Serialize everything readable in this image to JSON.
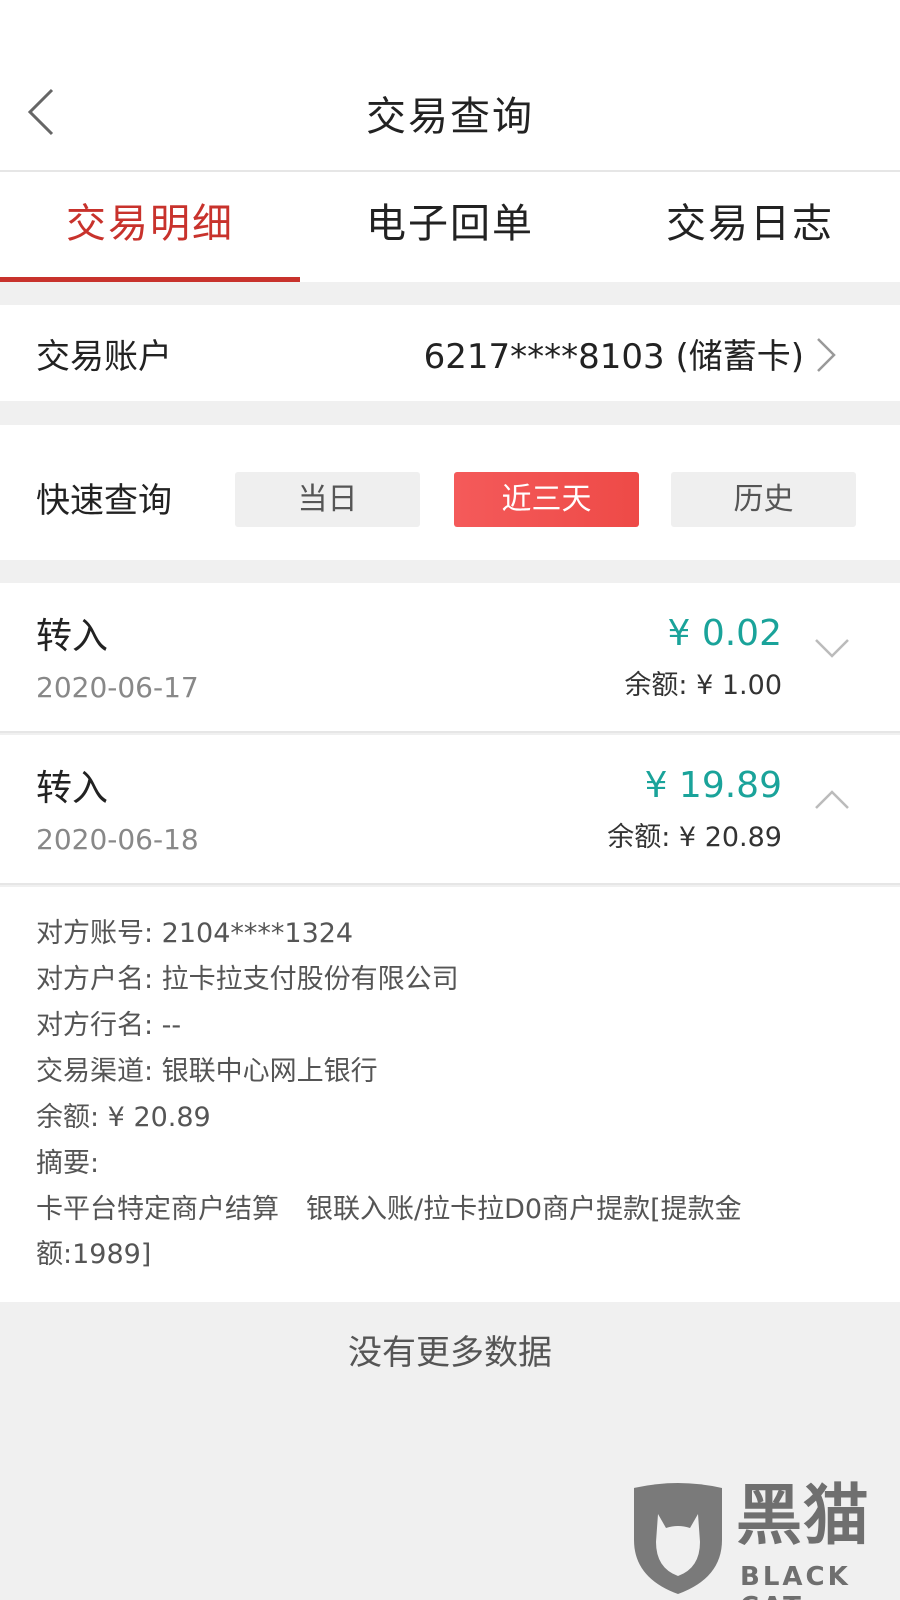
{
  "header": {
    "title": "交易查询"
  },
  "tabs": [
    {
      "label": "交易明细",
      "active": true
    },
    {
      "label": "电子回单",
      "active": false
    },
    {
      "label": "交易日志",
      "active": false
    }
  ],
  "account": {
    "label": "交易账户",
    "value": "6217****8103  (储蓄卡)"
  },
  "quick_query": {
    "label": "快速查询",
    "options": [
      "当日",
      "近三天",
      "历史"
    ],
    "selected": "近三天"
  },
  "transactions": [
    {
      "type": "转入",
      "date": "2020-06-17",
      "amount": "¥ 0.02",
      "balance": "余额: ¥ 1.00",
      "expanded": false
    },
    {
      "type": "转入",
      "date": "2020-06-18",
      "amount": "¥ 19.89",
      "balance": "余额: ¥ 20.89",
      "expanded": true
    }
  ],
  "details": {
    "counterparty_account": "对方账号: 2104****1324",
    "counterparty_name": "对方户名: 拉卡拉支付股份有限公司",
    "counterparty_bank": "对方行名: --",
    "channel": "交易渠道: 银联中心网上银行",
    "balance": "余额: ¥ 20.89",
    "summary_label": "摘要:",
    "summary": "卡平台特定商户结算　银联入账/拉卡拉D0商户提款[提款金额:1989]"
  },
  "footer": {
    "no_more": "没有更多数据"
  },
  "watermark": {
    "cn": "黑猫",
    "en": "BLACK CAT"
  },
  "colors": {
    "accent": "#c8322c",
    "amount": "#1aa39a",
    "selected_button": "#ef4c4a"
  }
}
